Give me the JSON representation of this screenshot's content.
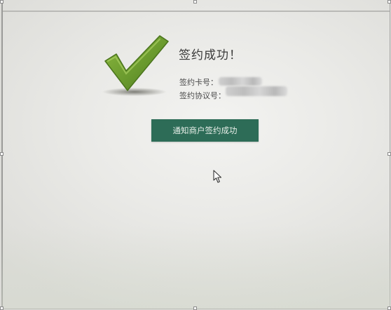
{
  "status": {
    "title": "签约成功！",
    "card_label": "签约卡号：",
    "agreement_label": "签约协议号："
  },
  "actions": {
    "notify_merchant_label": "通知商户签约成功"
  },
  "icons": {
    "success": "checkmark-icon",
    "pointer": "mouse-cursor-icon"
  },
  "colors": {
    "check_green": "#6a9a2e",
    "button_green": "#2d6c57"
  }
}
